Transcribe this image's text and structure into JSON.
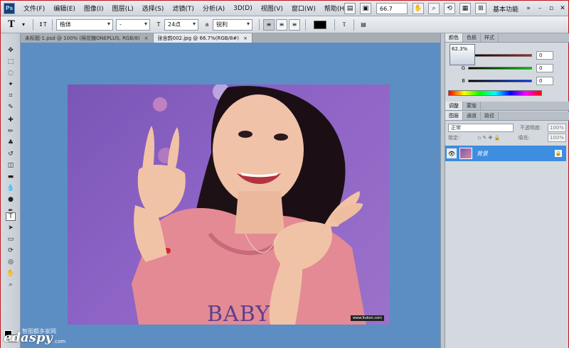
{
  "menubar": {
    "logo": "Ps",
    "items": [
      "文件(F)",
      "编辑(E)",
      "图像(I)",
      "图层(L)",
      "选择(S)",
      "滤镜(T)",
      "分析(A)",
      "3D(D)",
      "视图(V)",
      "窗口(W)",
      "帮助(H)"
    ],
    "zoom": "66.7",
    "workspace": "基本功能"
  },
  "options": {
    "tool_glyph": "T",
    "font_family": "楷体",
    "font_style": "-",
    "font_size": "24点",
    "aa_label": "a",
    "antialias": "锐利"
  },
  "tabs": [
    {
      "label": "未标题-1.psd @ 100% (棉花糖ONEPLUS, RGB/8)"
    },
    {
      "label": "张含韵002.jpg @ 66.7%(RGB/8#)"
    }
  ],
  "color_panel": {
    "tabs": [
      "颜色",
      "色板",
      "样式"
    ],
    "zoom_tip": "62.3%",
    "channels": [
      {
        "label": "R",
        "value": "0",
        "color": "#d01010"
      },
      {
        "label": "G",
        "value": "0",
        "color": "#10b010"
      },
      {
        "label": "B",
        "value": "0",
        "color": "#1040d0"
      }
    ]
  },
  "adjust_tabs": [
    "调整",
    "蒙版"
  ],
  "layers_panel": {
    "tabs": [
      "图层",
      "通道",
      "路径"
    ],
    "blend_mode": "正常",
    "opacity_label": "不透明度:",
    "opacity": "100%",
    "lock_label": "锁定:",
    "fill_label": "填充:",
    "fill": "100%",
    "layer_name": "背景"
  },
  "canvas": {
    "photo_text": "BABY",
    "photo_tag": "www.9ukon.com"
  },
  "watermark": {
    "logo": "edaspy",
    "cn": "智图都多家网",
    "com": ".com"
  }
}
